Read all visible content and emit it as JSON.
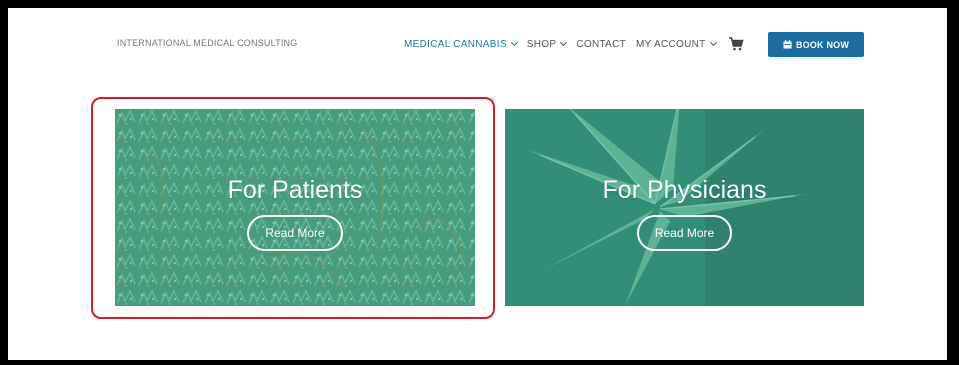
{
  "header": {
    "logo_text": "INTERNATIONAL MEDICAL CONSULTING",
    "nav": [
      {
        "label": "MEDICAL CANNABIS",
        "has_dropdown": true,
        "active": true
      },
      {
        "label": "SHOP",
        "has_dropdown": true
      },
      {
        "label": "CONTACT",
        "has_dropdown": false
      },
      {
        "label": "MY ACCOUNT",
        "has_dropdown": true
      }
    ],
    "cart_icon": "shopping-cart-icon",
    "book_button": {
      "label": "BOOK NOW",
      "icon": "calendar-icon"
    }
  },
  "cards": [
    {
      "title": "For Patients",
      "button_label": "Read More"
    },
    {
      "title": "For Physicians",
      "button_label": "Read More"
    }
  ],
  "colors": {
    "accent": "#1b79a8",
    "book_button_bg": "#1b6ca0",
    "card_overlay": "#3a9a84",
    "highlight": "#d21f26"
  }
}
